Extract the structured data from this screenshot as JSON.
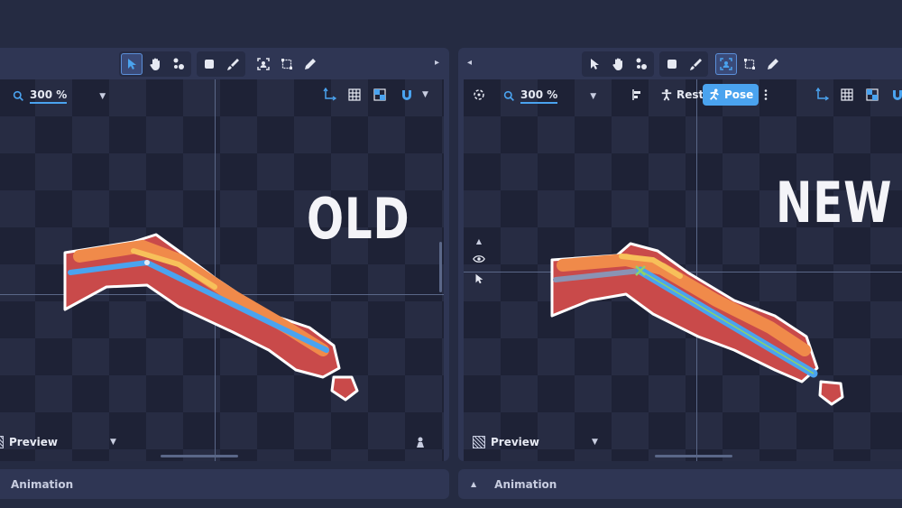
{
  "left_panel": {
    "zoom": "300 %",
    "overlay_label": "OLD",
    "preview_label": "Preview",
    "toolbar_arrow": "▸"
  },
  "right_panel": {
    "zoom": "300 %",
    "overlay_label": "NEW",
    "preview_label": "Preview",
    "toolbar_arrow": "◂",
    "rest_label": "Rest",
    "pose_label": "Pose"
  },
  "bottom": {
    "left_label": "Animation",
    "right_label": "Animation"
  },
  "colors": {
    "accent": "#4aa3ef",
    "panel": "#2f3654",
    "background": "#252b42"
  }
}
